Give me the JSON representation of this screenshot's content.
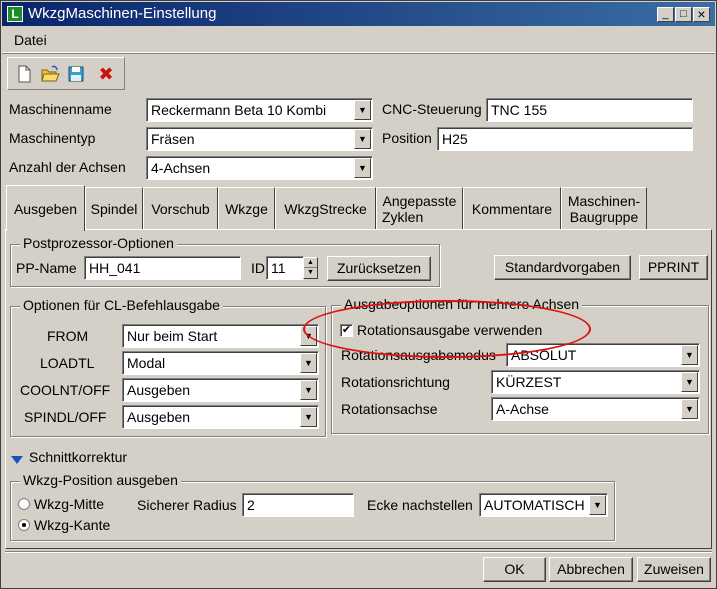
{
  "window": {
    "title": "WkzgMaschinen-Einstellung",
    "app_icon_letter": "L",
    "minimize": "_",
    "maximize": "□",
    "close": "×"
  },
  "menu": {
    "datei": "Datei"
  },
  "toolbar": {
    "new_icon": "new-file-icon",
    "open_icon": "open-folder-icon",
    "save_icon": "save-icon",
    "delete_icon": "delete-x-icon",
    "delete_glyph": "✖"
  },
  "machine": {
    "name_label": "Maschinenname",
    "name_value": "Reckermann Beta 10 Kombi",
    "type_label": "Maschinentyp",
    "type_value": "Fräsen",
    "axes_label": "Anzahl der Achsen",
    "axes_value": "4-Achsen",
    "cnc_label": "CNC-Steuerung",
    "cnc_value": "TNC 155",
    "position_label": "Position",
    "position_value": "H25"
  },
  "tabs": [
    {
      "label": "Ausgeben"
    },
    {
      "label": "Spindel"
    },
    {
      "label": "Vorschub"
    },
    {
      "label": "Wkzge"
    },
    {
      "label": "WkzgStrecke"
    },
    {
      "label_line1": "Angepasste",
      "label_line2": "Zyklen"
    },
    {
      "label": "Kommentare"
    },
    {
      "label_line1": "Maschinen-",
      "label_line2": "Baugruppe"
    }
  ],
  "pp_options": {
    "title": "Postprozessor-Optionen",
    "pp_name_label": "PP-Name",
    "pp_name_value": "HH_041",
    "id_label": "ID",
    "id_value": "11",
    "reset_button": "Zurücksetzen",
    "defaults_button": "Standardvorgaben",
    "pprint_button": "PPRINT"
  },
  "cl_options": {
    "title": "Optionen für CL-Befehlausgabe",
    "rows": [
      {
        "label": "FROM",
        "value": "Nur beim Start"
      },
      {
        "label": "LOADTL",
        "value": "Modal"
      },
      {
        "label": "COOLNT/OFF",
        "value": "Ausgeben"
      },
      {
        "label": "SPINDL/OFF",
        "value": "Ausgeben"
      }
    ]
  },
  "multi_axis": {
    "title": "Ausgabeoptionen für mehrere Achsen",
    "checkbox_label": "Rotationsausgabe verwenden",
    "checkbox_mark": "✔",
    "mode_label": "Rotationsausgabemodus",
    "mode_value": "ABSOLUT",
    "direction_label": "Rotationsrichtung",
    "direction_value": "KÜRZEST",
    "axis_label": "Rotationsachse",
    "axis_value": "A-Achse"
  },
  "cutter_comp": {
    "section_label": "Schnittkorrektur",
    "group_title": "Wkzg-Position ausgeben",
    "radio_center": "Wkzg-Mitte",
    "radio_edge": "Wkzg-Kante",
    "safe_radius_label": "Sicherer Radius",
    "safe_radius_value": "2",
    "corner_label": "Ecke nachstellen",
    "corner_value": "AUTOMATISCH"
  },
  "footer": {
    "ok": "OK",
    "cancel": "Abbrechen",
    "assign": "Zuweisen"
  },
  "colors": {
    "annotation_ellipse": "#e01010",
    "dialog_face": "#d4d0c8",
    "titlebar_start": "#0a246a",
    "titlebar_end": "#3a6ea5"
  },
  "arrow_glyph": "▼"
}
